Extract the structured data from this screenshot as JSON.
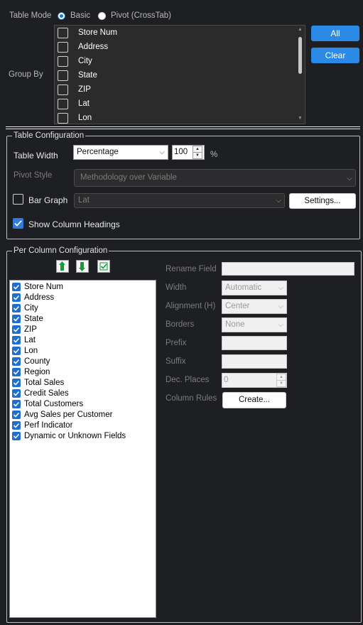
{
  "table_mode": {
    "label": "Table Mode",
    "options": [
      "Basic",
      "Pivot (CrossTab)"
    ],
    "selected": "Basic"
  },
  "group_by": {
    "label": "Group By",
    "items": [
      "Store Num",
      "Address",
      "City",
      "State",
      "ZIP",
      "Lat",
      "Lon"
    ],
    "all_button": "All",
    "clear_button": "Clear"
  },
  "table_configuration": {
    "legend": "Table Configuration",
    "table_width_label": "Table Width",
    "width_mode": "Percentage",
    "width_value": "100",
    "width_unit": "%",
    "pivot_style_label": "Pivot Style",
    "pivot_style_value": "Methodology over Variable",
    "bar_graph_label": "Bar Graph",
    "bar_graph_field": "Lat",
    "settings_button": "Settings...",
    "show_headings_label": "Show Column Headings"
  },
  "per_column": {
    "legend": "Per Column Configuration",
    "columns": [
      "Store Num",
      "Address",
      "City",
      "State",
      "ZIP",
      "Lat",
      "Lon",
      "County",
      "Region",
      "Total Sales",
      "Credit Sales",
      "Total Customers",
      "Avg Sales per Customer",
      "Perf Indicator",
      "Dynamic or Unknown Fields"
    ],
    "rename_field_label": "Rename Field",
    "width_label": "Width",
    "width_value": "Automatic",
    "alignment_label": "Alignment (H)",
    "alignment_value": "Center",
    "borders_label": "Borders",
    "borders_value": "None",
    "prefix_label": "Prefix",
    "suffix_label": "Suffix",
    "dec_places_label": "Dec. Places",
    "dec_places_value": "0",
    "column_rules_label": "Column Rules",
    "create_button": "Create..."
  },
  "colors": {
    "background": "#1e1f22",
    "accent_blue": "#2a8ae6",
    "checkbox_blue": "#2f7dd6"
  }
}
